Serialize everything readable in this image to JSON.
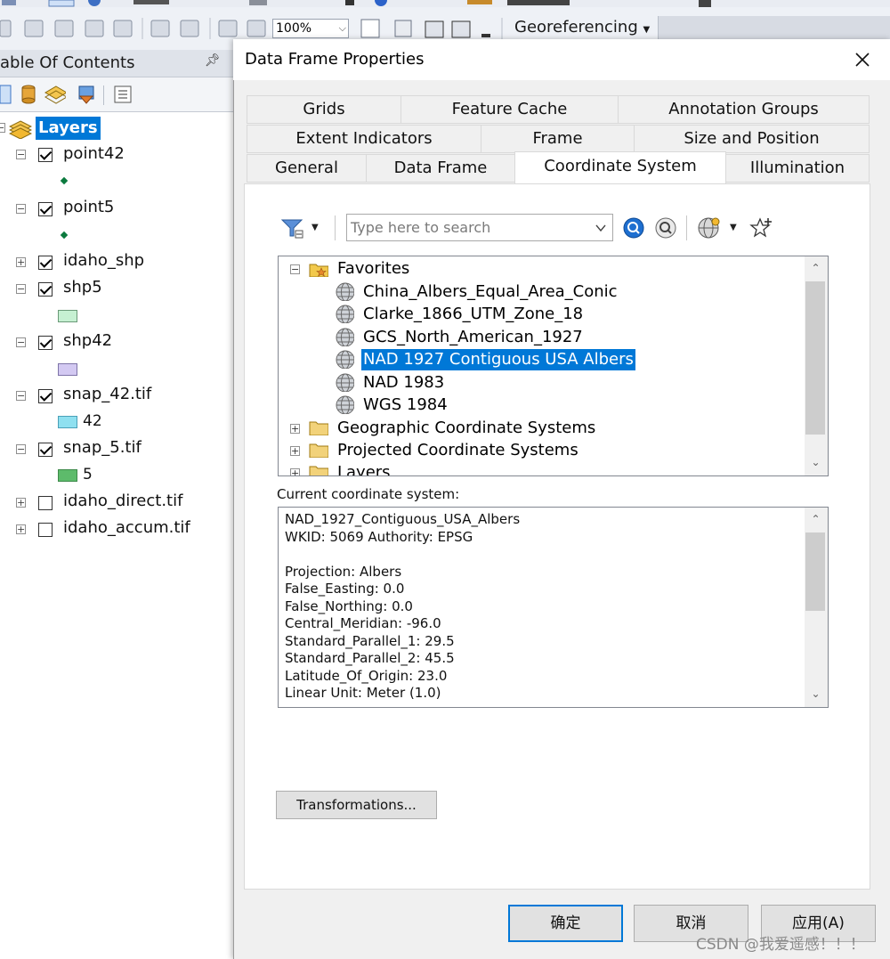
{
  "toolbar": {
    "zoom_value": "100%",
    "georeferencing_label": "Georeferencing"
  },
  "toc": {
    "title": "able Of Contents",
    "root_label": "Layers",
    "layers": [
      {
        "name": "point42",
        "checked": true,
        "legend": ""
      },
      {
        "name": "point5",
        "checked": true,
        "legend": ""
      },
      {
        "name": "idaho_shp",
        "checked": true,
        "legend": ""
      },
      {
        "name": "shp5",
        "checked": true,
        "legend": ""
      },
      {
        "name": "shp42",
        "checked": true,
        "legend": ""
      },
      {
        "name": "snap_42.tif",
        "checked": true,
        "legend": "42"
      },
      {
        "name": "snap_5.tif",
        "checked": true,
        "legend": "5"
      },
      {
        "name": "idaho_direct.tif",
        "checked": false,
        "legend": ""
      },
      {
        "name": "idaho_accum.tif",
        "checked": false,
        "legend": ""
      }
    ],
    "colors": {
      "point_symbol": "#0b7a3e",
      "shp5_fill": "#c6f0d2",
      "shp42_fill": "#d3c9f2",
      "snap42_fill": "#8fe0f0",
      "snap5_fill": "#5dbb6b"
    }
  },
  "dialog": {
    "title": "Data Frame Properties",
    "tabs": {
      "row1": [
        "Grids",
        "Feature Cache",
        "Annotation Groups"
      ],
      "row2": [
        "Extent Indicators",
        "Frame",
        "Size and Position"
      ],
      "row3": [
        "General",
        "Data Frame",
        "Coordinate System",
        "Illumination"
      ]
    },
    "active_tab": "Coordinate System",
    "search": {
      "placeholder": "Type here to search"
    },
    "tree": {
      "favorites_label": "Favorites",
      "favorites": [
        "China_Albers_Equal_Area_Conic",
        "Clarke_1866_UTM_Zone_18",
        "GCS_North_American_1927",
        "NAD 1927 Contiguous USA Albers",
        "NAD 1983",
        "WGS 1984"
      ],
      "selected": "NAD 1927 Contiguous USA Albers",
      "groups": [
        "Geographic Coordinate Systems",
        "Projected Coordinate Systems",
        "Layers"
      ]
    },
    "current_label": "Current coordinate system:",
    "current_lines": [
      "NAD_1927_Contiguous_USA_Albers",
      "WKID: 5069 Authority: EPSG",
      "",
      "Projection: Albers",
      "False_Easting: 0.0",
      "False_Northing: 0.0",
      "Central_Meridian: -96.0",
      "Standard_Parallel_1: 29.5",
      "Standard_Parallel_2: 45.5",
      "Latitude_Of_Origin: 23.0",
      "Linear Unit: Meter (1.0)"
    ],
    "transformations_label": "Transformations...",
    "buttons": {
      "ok": "确定",
      "cancel": "取消",
      "apply": "应用(A)"
    },
    "accent": "#0078d7"
  },
  "watermark": "CSDN @我爱遥感！！！"
}
